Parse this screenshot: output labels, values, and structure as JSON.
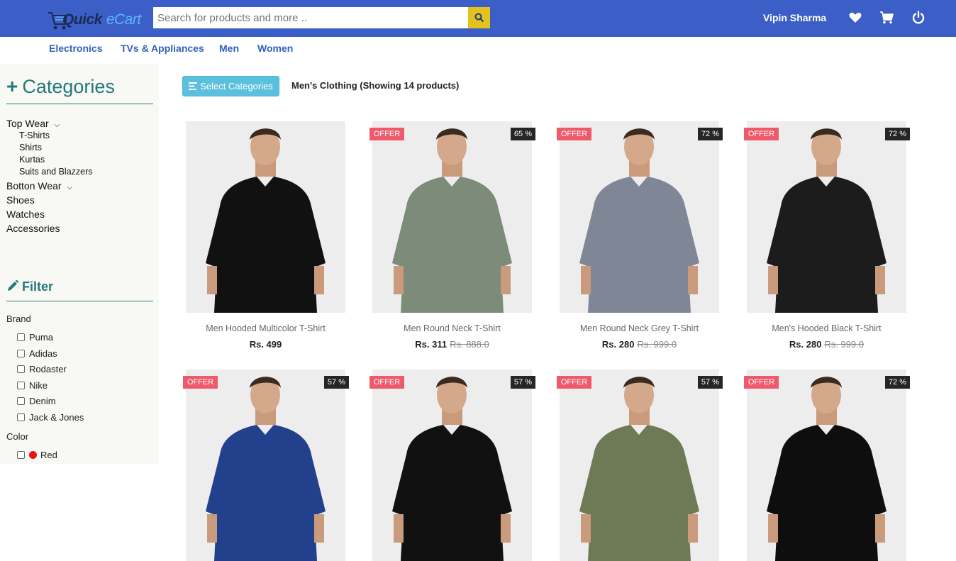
{
  "header": {
    "logo_part1": "Quick",
    "logo_part2": "eCart",
    "search_placeholder": "Search for products and more ..",
    "username": "Vipin Sharma",
    "icons": [
      "search-icon",
      "heart-icon",
      "cart-icon",
      "power-icon"
    ],
    "brand_color": "#3b5fc7",
    "search_button_color": "#e3c31b"
  },
  "nav": {
    "items": [
      "Electronics",
      "TVs & Appliances",
      "Men",
      "Women"
    ]
  },
  "sidebar": {
    "categories_title": "Categories",
    "categories": [
      {
        "label": "Top Wear",
        "expandable": true
      },
      {
        "label": "T-Shirts"
      },
      {
        "label": "Shirts"
      },
      {
        "label": "Kurtas"
      },
      {
        "label": "Suits and Blazzers"
      },
      {
        "label": "Botton Wear",
        "expandable": true
      },
      {
        "label": "Shoes"
      },
      {
        "label": "Watches"
      },
      {
        "label": "Accessories"
      }
    ],
    "filter_title": "Filter",
    "brand_label": "Brand",
    "brands": [
      "Puma",
      "Adidas",
      "Rodaster",
      "Nike",
      "Denim",
      "Jack & Jones"
    ],
    "color_label": "Color",
    "colors": [
      {
        "label": "Red",
        "swatch": "#ee1111"
      }
    ]
  },
  "main": {
    "select_categories_label": "Select Categories",
    "showing_text": "Men's Clothing (Showing 14 products)",
    "offer_label": "OFFER",
    "products": [
      {
        "name": "Men Hooded Multicolor T-Shirt",
        "price": "Rs. 499",
        "old_price": "",
        "discount": "",
        "offer": false,
        "shirt": "#111111"
      },
      {
        "name": "Men Round Neck T-Shirt",
        "price": "Rs. 311",
        "old_price": "Rs. 888.0",
        "discount": "65 %",
        "offer": true,
        "shirt": "#7d8c78"
      },
      {
        "name": "Men Round Neck Grey T-Shirt",
        "price": "Rs. 280",
        "old_price": "Rs. 999.0",
        "discount": "72 %",
        "offer": true,
        "shirt": "#7f8696"
      },
      {
        "name": "Men's Hooded Black T-Shirt",
        "price": "Rs. 280",
        "old_price": "Rs. 999.0",
        "discount": "72 %",
        "offer": true,
        "shirt": "#1c1c1c"
      },
      {
        "name": "",
        "price": "",
        "old_price": "",
        "discount": "57 %",
        "offer": true,
        "shirt": "#23408c"
      },
      {
        "name": "",
        "price": "",
        "old_price": "",
        "discount": "57 %",
        "offer": true,
        "shirt": "#111111"
      },
      {
        "name": "",
        "price": "",
        "old_price": "",
        "discount": "57 %",
        "offer": true,
        "shirt": "#6e7a55"
      },
      {
        "name": "",
        "price": "",
        "old_price": "",
        "discount": "72 %",
        "offer": true,
        "shirt": "#0e0e0e"
      }
    ]
  }
}
